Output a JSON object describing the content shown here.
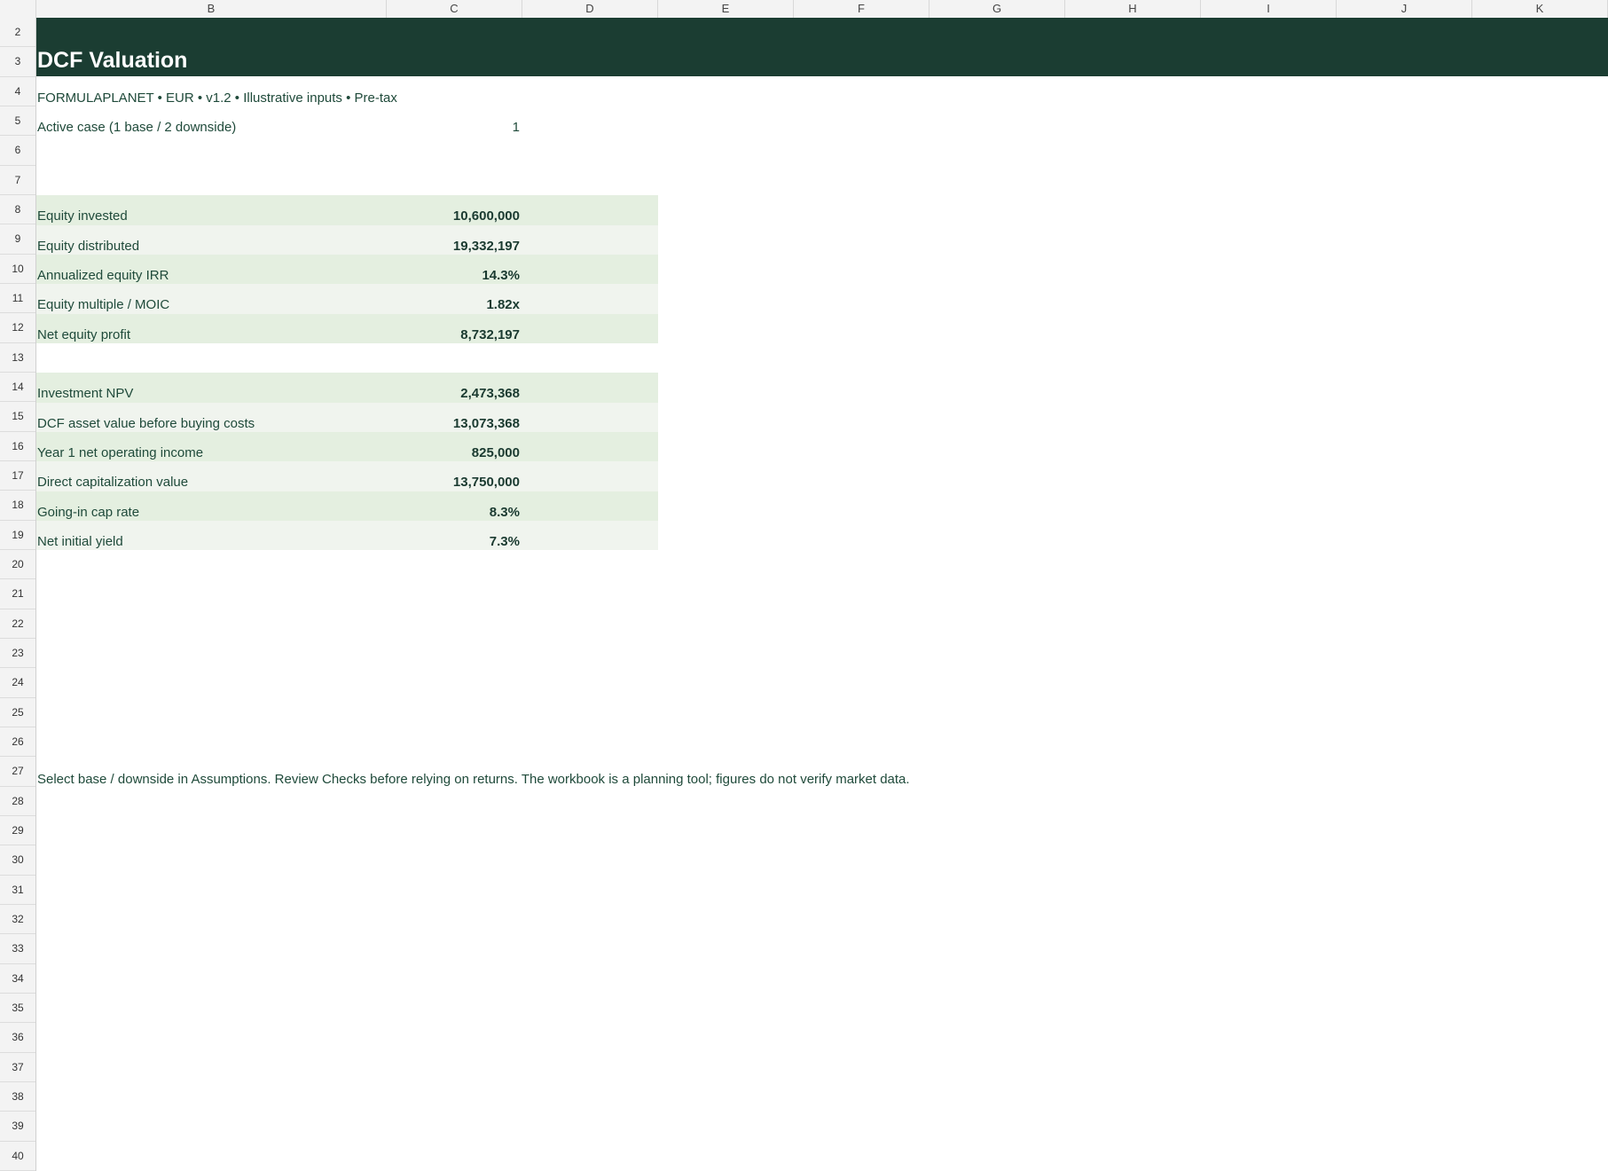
{
  "columns": [
    "B",
    "C",
    "D",
    "E",
    "F",
    "G",
    "H",
    "I",
    "J",
    "K"
  ],
  "rows": [
    "2",
    "3",
    "4",
    "5",
    "6",
    "7",
    "8",
    "9",
    "10",
    "11",
    "12",
    "13",
    "14",
    "15",
    "16",
    "17",
    "18",
    "19",
    "20",
    "21",
    "22",
    "23",
    "24",
    "25",
    "26",
    "27",
    "28",
    "29",
    "30",
    "31",
    "32",
    "33",
    "34",
    "35",
    "36",
    "37",
    "38",
    "39",
    "40"
  ],
  "title": "DCF Valuation",
  "subtitle": "FORMULAPLANET  •  EUR  •  v1.2  •  Illustrative inputs  •  Pre-tax",
  "active_case": {
    "label": "Active case (1 base / 2 downside)",
    "value": "1"
  },
  "returns": [
    {
      "label": "Equity invested",
      "value": "10,600,000"
    },
    {
      "label": "Equity distributed",
      "value": "19,332,197"
    },
    {
      "label": "Annualized equity IRR",
      "value": "14.3%"
    },
    {
      "label": "Equity multiple / MOIC",
      "value": "1.82x"
    },
    {
      "label": "Net equity profit",
      "value": "8,732,197"
    }
  ],
  "valuation": [
    {
      "label": "Investment NPV",
      "value": "2,473,368"
    },
    {
      "label": "DCF asset value before buying costs",
      "value": "13,073,368"
    },
    {
      "label": "Year 1 net operating income",
      "value": "825,000"
    },
    {
      "label": "Direct capitalization value",
      "value": "13,750,000"
    },
    {
      "label": "Going-in cap rate",
      "value": "8.3%"
    },
    {
      "label": "Net initial yield",
      "value": "7.3%"
    }
  ],
  "note": "Select base / downside in Assumptions. Review Checks before relying on returns. The workbook is a planning tool; figures do not verify market data."
}
